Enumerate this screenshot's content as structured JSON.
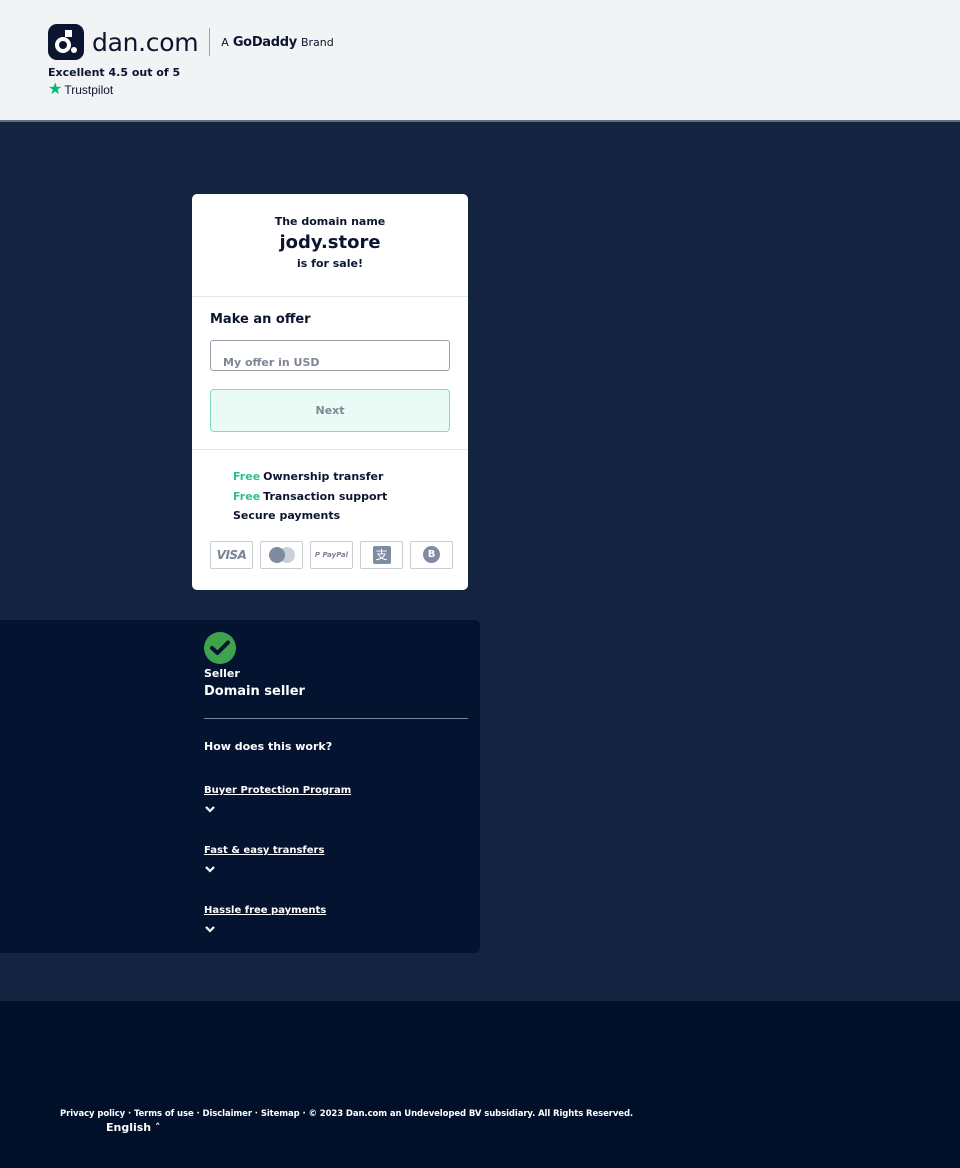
{
  "header": {
    "logo_text": "dan.com",
    "brand_prefix": "A",
    "brand_name": "GoDaddy",
    "brand_suffix": "Brand",
    "rating": "Excellent 4.5 out of 5",
    "trustpilot": "Trustpilot"
  },
  "card": {
    "line1": "The domain name",
    "domain": "jody.store",
    "line3": "is for sale!",
    "offer_title": "Make an offer",
    "offer_placeholder": "My offer in USD",
    "offer_value": "",
    "next_label": "Next",
    "perks": [
      {
        "free": "Free",
        "text": "Ownership transfer"
      },
      {
        "free": "Free",
        "text": "Transaction support"
      },
      {
        "free": "",
        "text": "Secure payments"
      }
    ],
    "payment_methods": [
      {
        "name": "visa",
        "label": "VISA"
      },
      {
        "name": "mastercard",
        "label": ""
      },
      {
        "name": "paypal",
        "label": "P PayPal"
      },
      {
        "name": "alipay",
        "label": "支"
      },
      {
        "name": "bitcoin",
        "label": "B"
      }
    ]
  },
  "info": {
    "seller_label": "Seller",
    "seller_name": "Domain seller",
    "how_title": "How does this work?",
    "faq": [
      {
        "label": "Buyer Protection Program"
      },
      {
        "label": "Fast & easy transfers"
      },
      {
        "label": "Hassle free payments"
      }
    ]
  },
  "footer": {
    "links": [
      "Privacy policy",
      "Terms of use",
      "Disclaimer",
      "Sitemap"
    ],
    "separator": " · ",
    "copyright": "© 2023 Dan.com an Undeveloped BV subsidiary. All Rights Reserved.",
    "language": "English",
    "language_caret": "˄"
  },
  "colors": {
    "accent_green": "#2fbf8c",
    "navy": "#0b1530",
    "page_bg": "#132340",
    "panel_bg": "#041430",
    "footer_bg": "#011029",
    "check_green": "#3fa34d"
  }
}
